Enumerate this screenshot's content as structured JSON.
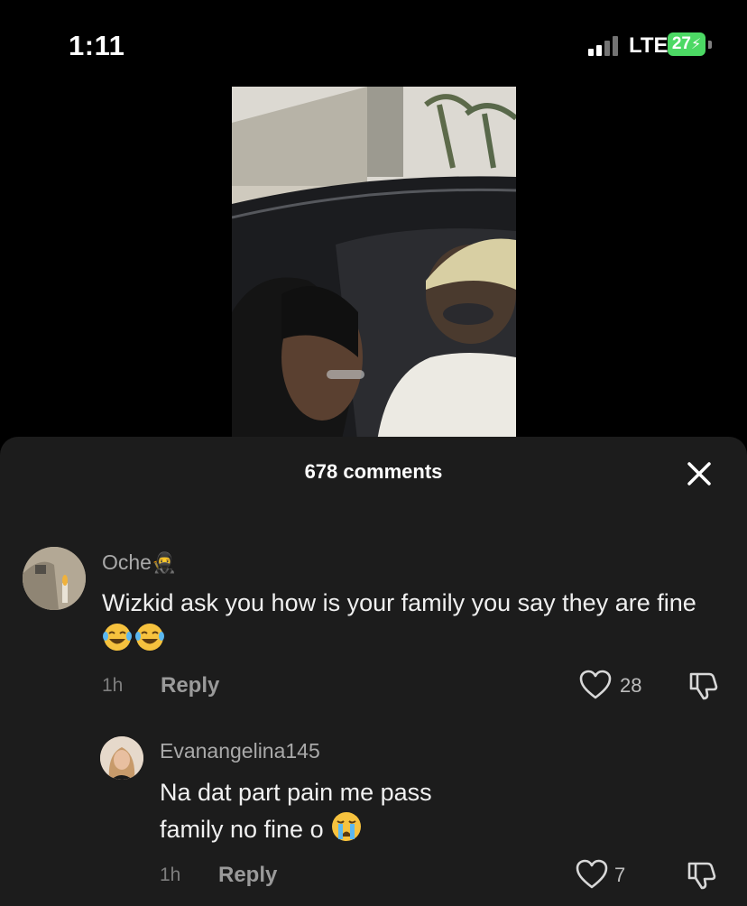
{
  "status_bar": {
    "time": "1:11",
    "network": "LTE",
    "battery": "27"
  },
  "comments_sheet": {
    "title": "678 comments",
    "comments": [
      {
        "username": "Oche",
        "text": "Wizkid ask you how is your family you say they are fine",
        "time": "1h",
        "reply_label": "Reply",
        "likes": "28"
      },
      {
        "username": "Evanangelina145",
        "text": "Na dat part pain me pass family no fine o",
        "time": "1h",
        "reply_label": "Reply",
        "likes": "7"
      }
    ]
  },
  "colors": {
    "background": "#000000",
    "sheet": "#1c1c1c",
    "battery": "#4cd964"
  }
}
